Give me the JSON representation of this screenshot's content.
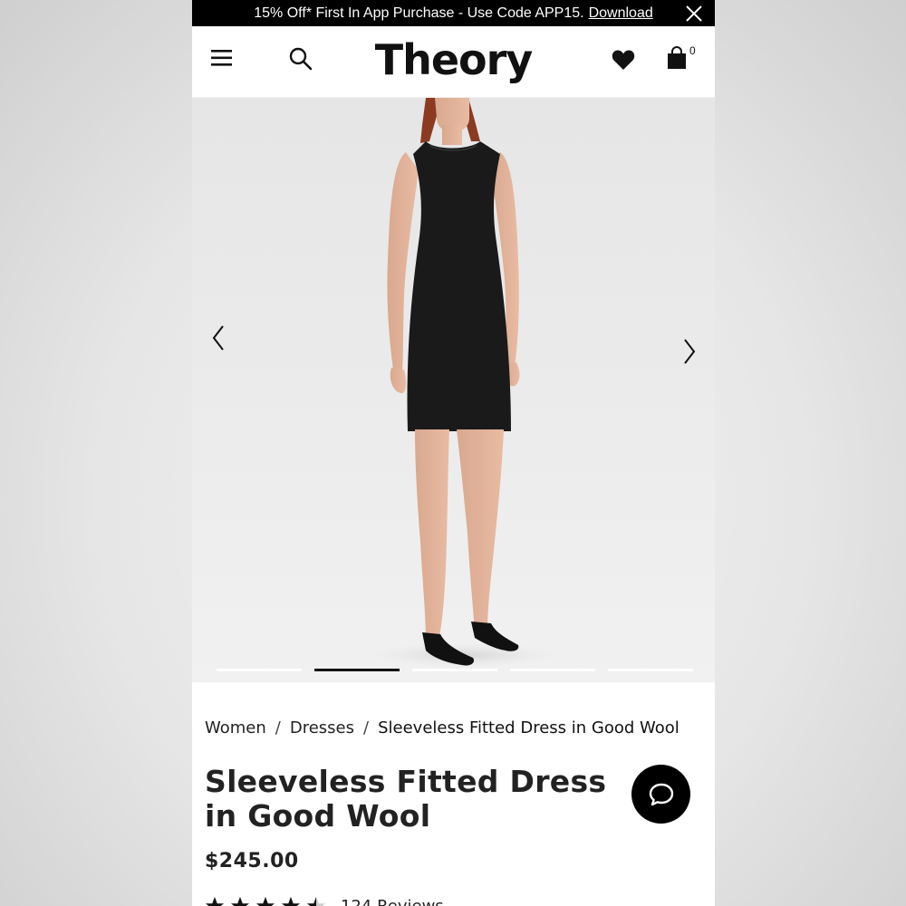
{
  "promo": {
    "text": "15% Off* First In App Purchase - Use Code APP15.",
    "link": "Download"
  },
  "header": {
    "logo": "Theory",
    "bag_count": "0",
    "icons": [
      "menu-icon",
      "search-icon",
      "heart-icon",
      "bag-icon"
    ]
  },
  "gallery": {
    "slide_count": 5,
    "active_slide": 2,
    "icons": [
      "chevron-left-icon",
      "chevron-right-icon"
    ]
  },
  "breadcrumb": {
    "items": [
      "Women",
      "Dresses",
      "Sleeveless Fitted Dress in Good Wool"
    ],
    "separator": "/"
  },
  "product": {
    "title": "Sleeveless Fitted Dress in Good Wool",
    "price": "$245.00",
    "rating": 4.5,
    "reviews_label": "124 Reviews"
  },
  "colors": {
    "banner_bg": "#000000",
    "text": "#222222",
    "dress": "#1a1a1a"
  }
}
